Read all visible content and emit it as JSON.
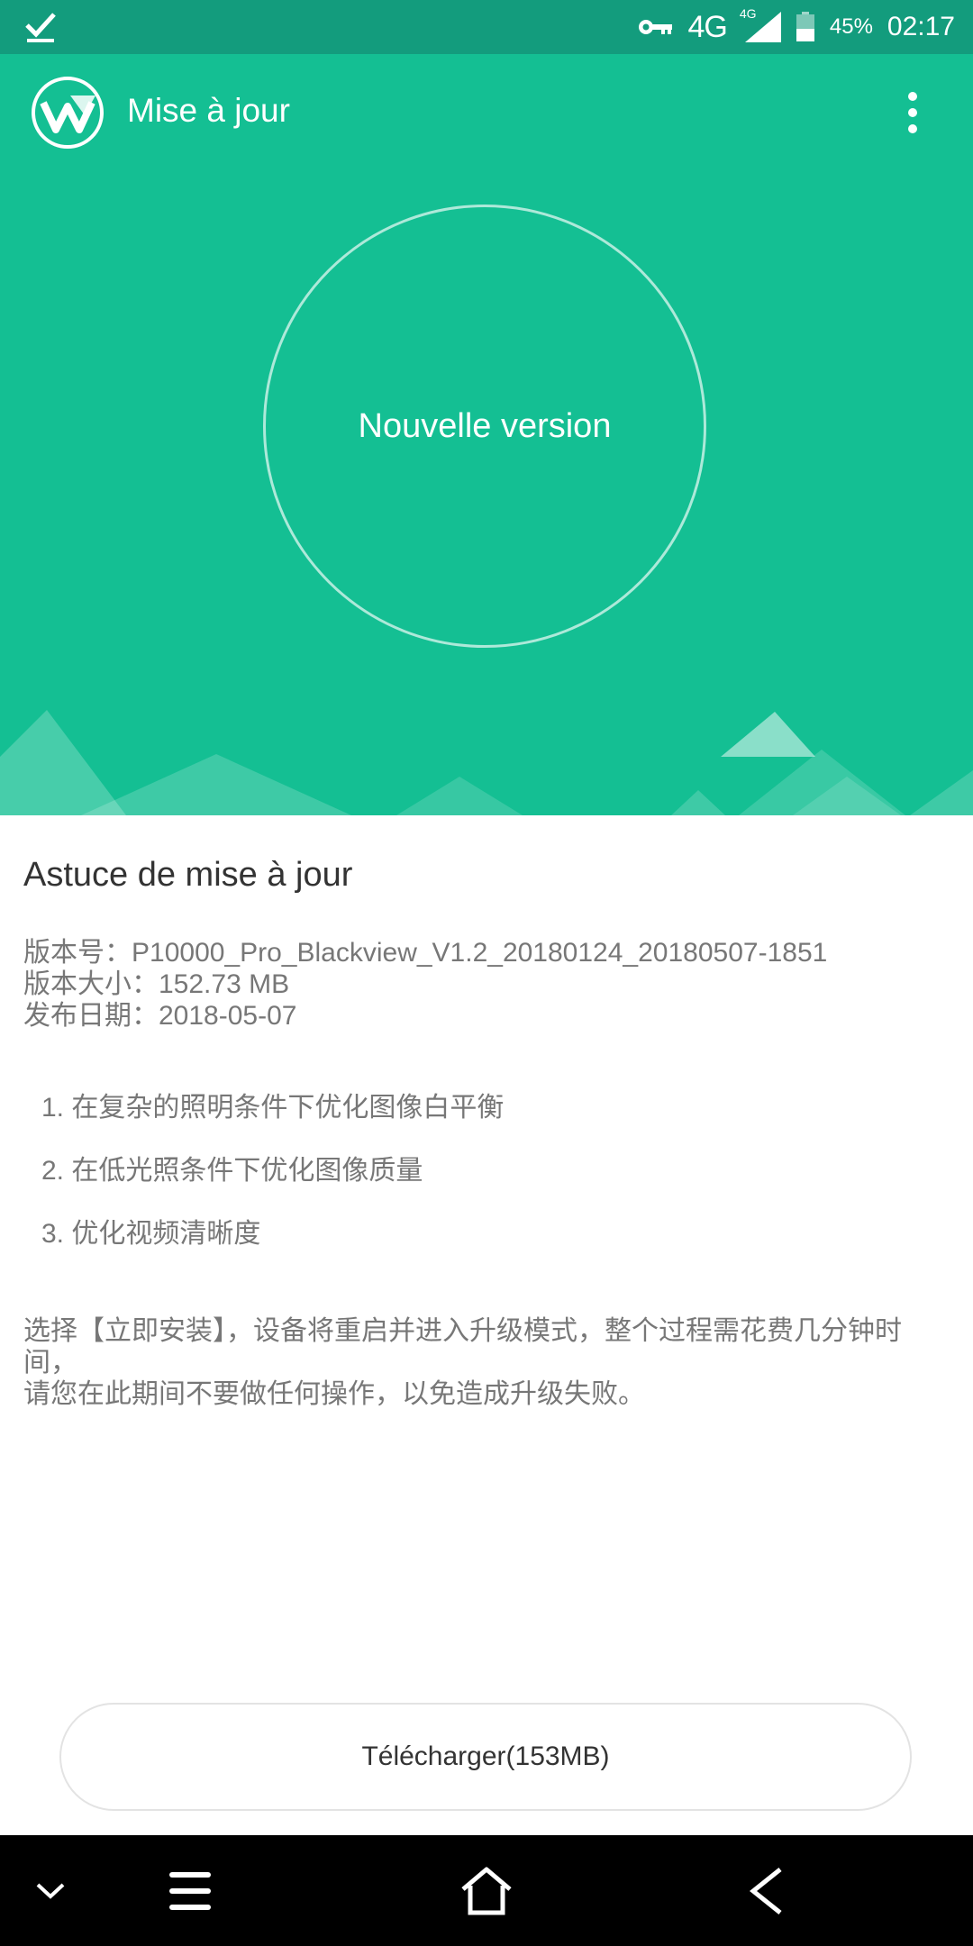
{
  "status_bar": {
    "network": "4G",
    "network_small": "4G",
    "battery": "45%",
    "time": "02:17"
  },
  "header": {
    "title": "Mise à jour",
    "circle_label": "Nouvelle version"
  },
  "content": {
    "tip_title": "Astuce de mise à jour",
    "version_line": "版本号：P10000_Pro_Blackview_V1.2_20180124_20180507-1851",
    "size_line": "版本大小：152.73 MB",
    "date_line": "发布日期：2018-05-07",
    "changes": [
      "1. 在复杂的照明条件下优化图像白平衡",
      "2. 在低光照条件下优化图像质量",
      "3. 优化视频清晰度"
    ],
    "note_line1": "选择【立即安装】，设备将重启并进入升级模式，整个过程需花费几分钟时间，",
    "note_line2": "请您在此期间不要做任何操作，以免造成升级失败。"
  },
  "download_button": "Télécharger(153MB)",
  "colors": {
    "header_green": "#14bf93",
    "status_green": "#139c7d"
  },
  "icons": [
    "download-done-icon",
    "vpn-key-icon",
    "signal-icon",
    "battery-icon",
    "app-logo-icon",
    "more-vert-icon",
    "chevron-down-icon",
    "menu-icon",
    "home-icon",
    "back-icon"
  ]
}
